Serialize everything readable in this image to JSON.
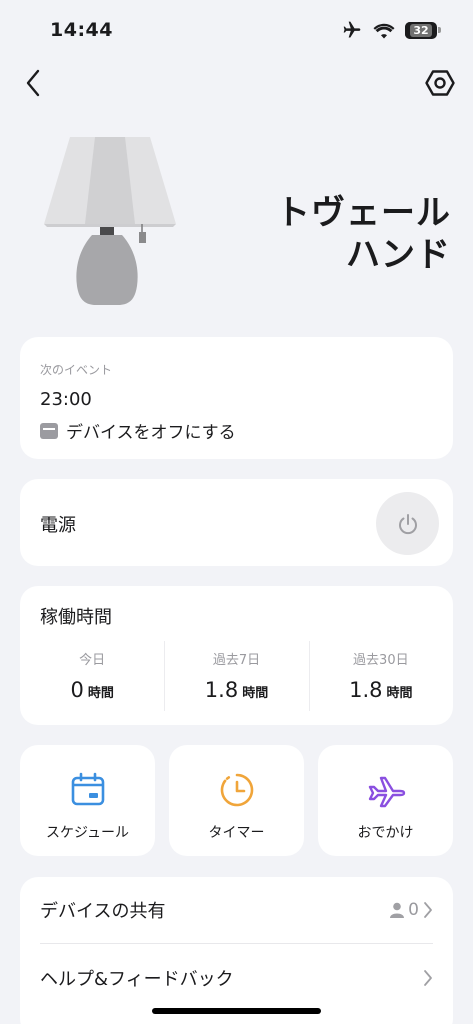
{
  "status_bar": {
    "time": "14:44",
    "battery": "32"
  },
  "device": {
    "name_line1": "トヴェール",
    "name_line2": "ハンド"
  },
  "next_event": {
    "label": "次のイベント",
    "time": "23:00",
    "action": "デバイスをオフにする"
  },
  "power": {
    "label": "電源"
  },
  "runtime": {
    "title": "稼働時間",
    "stats": [
      {
        "label": "今日",
        "value": "0",
        "unit": "時間"
      },
      {
        "label": "過去7日",
        "value": "1.8",
        "unit": "時間"
      },
      {
        "label": "過去30日",
        "value": "1.8",
        "unit": "時間"
      }
    ]
  },
  "quick_actions": [
    {
      "label": "スケジュール",
      "icon": "calendar-icon",
      "color": "#3b8fe0"
    },
    {
      "label": "タイマー",
      "icon": "timer-icon",
      "color": "#f0a53a"
    },
    {
      "label": "おでかけ",
      "icon": "airplane-icon",
      "color": "#8a4fe0"
    }
  ],
  "list": {
    "share_label": "デバイスの共有",
    "share_count": "0",
    "help_label": "ヘルプ&フィードバック"
  }
}
